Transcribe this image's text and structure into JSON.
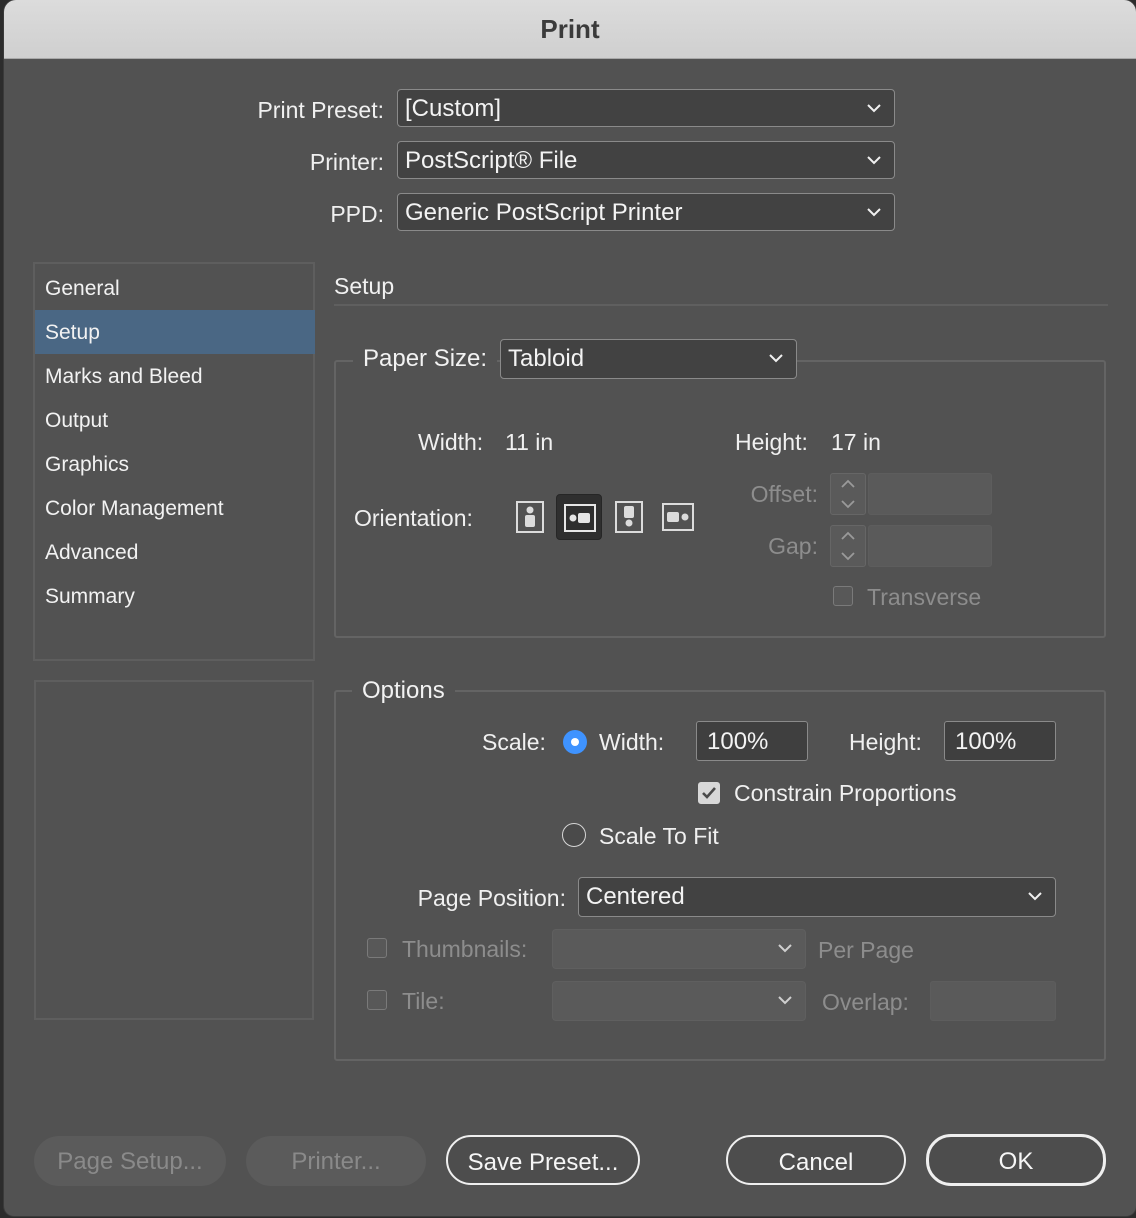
{
  "dialog": {
    "title": "Print"
  },
  "top": {
    "print_preset_label": "Print Preset:",
    "print_preset_value": "[Custom]",
    "printer_label": "Printer:",
    "printer_value": "PostScript® File",
    "ppd_label": "PPD:",
    "ppd_value": "Generic PostScript Printer"
  },
  "sidebar": {
    "items": [
      {
        "label": "General"
      },
      {
        "label": "Setup",
        "selected": true
      },
      {
        "label": "Marks and Bleed"
      },
      {
        "label": "Output"
      },
      {
        "label": "Graphics"
      },
      {
        "label": "Color Management"
      },
      {
        "label": "Advanced"
      },
      {
        "label": "Summary"
      }
    ]
  },
  "setup": {
    "heading": "Setup",
    "paper_size_label": "Paper Size:",
    "paper_size_value": "Tabloid",
    "width_label": "Width:",
    "width_value": "11 in",
    "height_label": "Height:",
    "height_value": "17 in",
    "orientation_label": "Orientation:",
    "orientation_icons": [
      "portrait-icon",
      "landscape-icon",
      "reverse-portrait-icon",
      "reverse-landscape-icon"
    ],
    "orientation_selected": "landscape-icon",
    "offset_label": "Offset:",
    "gap_label": "Gap:",
    "transverse_label": "Transverse",
    "transverse_checked": false
  },
  "options": {
    "heading": "Options",
    "scale_label": "Scale:",
    "scale_mode": "width",
    "width_label": "Width:",
    "width_value": "100%",
    "height_label": "Height:",
    "height_value": "100%",
    "constrain_label": "Constrain Proportions",
    "constrain_checked": true,
    "scale_to_fit_label": "Scale To Fit",
    "page_position_label": "Page Position:",
    "page_position_value": "Centered",
    "thumbnails_label": "Thumbnails:",
    "thumbnails_checked": false,
    "per_page_label": "Per Page",
    "tile_label": "Tile:",
    "tile_checked": false,
    "overlap_label": "Overlap:"
  },
  "buttons": {
    "page_setup": "Page Setup...",
    "printer": "Printer...",
    "save_preset": "Save Preset...",
    "cancel": "Cancel",
    "ok": "OK"
  },
  "colors": {
    "dialog_bg": "#525252",
    "selection": "#4a6784",
    "radio_accent": "#3f93ff"
  }
}
